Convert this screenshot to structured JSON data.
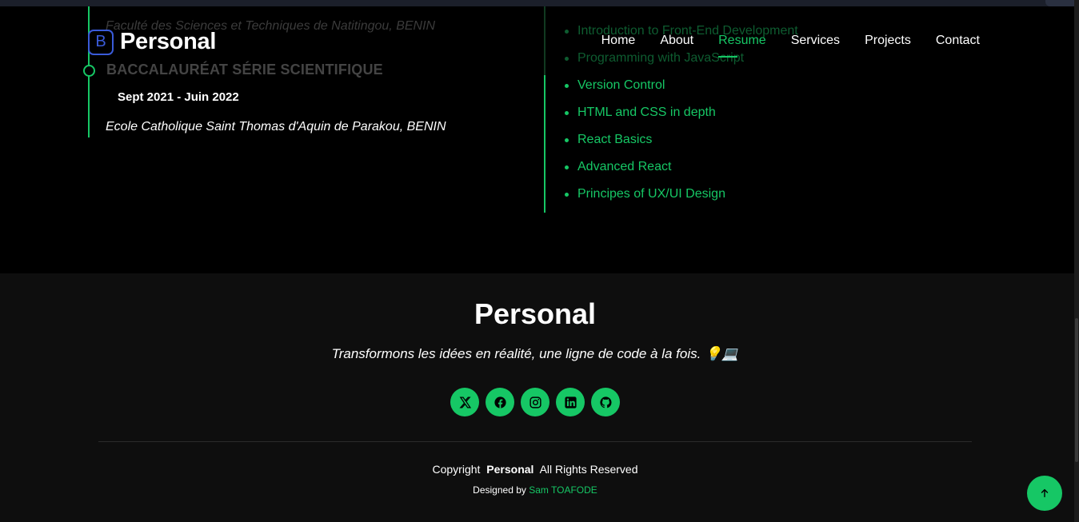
{
  "header": {
    "brand_icon": "B",
    "brand_name": "Personal",
    "nav": [
      {
        "label": "Home"
      },
      {
        "label": "About"
      },
      {
        "label": "Resume"
      },
      {
        "label": "Services"
      },
      {
        "label": "Projects"
      },
      {
        "label": "Contact"
      }
    ],
    "active_nav": "Resume"
  },
  "education": {
    "faded_school": "Faculté des Sciences et Techniques de Natitingou, BENIN",
    "title": "BACCALAURÉAT SÉRIE SCIENTIFIQUE",
    "date": "Sept 2021 - Juin 2022",
    "school": "Ecole Catholique Saint Thomas d'Aquin de Parakou, BENIN"
  },
  "courses": [
    "Introduction to Front-End Development",
    "Programming with JavaScript",
    "Version Control",
    "HTML and CSS in depth",
    "React Basics",
    "Advanced React",
    "Principes of UX/UI Design"
  ],
  "footer": {
    "title": "Personal",
    "tagline": "Transformons les idées en réalité, une ligne de code à la fois. 💡💻",
    "socials": [
      "x-icon",
      "facebook-icon",
      "instagram-icon",
      "linkedin-icon",
      "github-icon"
    ],
    "copyright_prefix": "Copyright",
    "copyright_name": "Personal",
    "copyright_suffix": "All Rights Reserved",
    "designed_prefix": "Designed by",
    "designed_name": "Sam TOAFODE"
  },
  "colors": {
    "accent": "#16c765",
    "brand_icon": "#3a5bd9",
    "background": "#000000",
    "footer_background": "#0e0e0e"
  }
}
